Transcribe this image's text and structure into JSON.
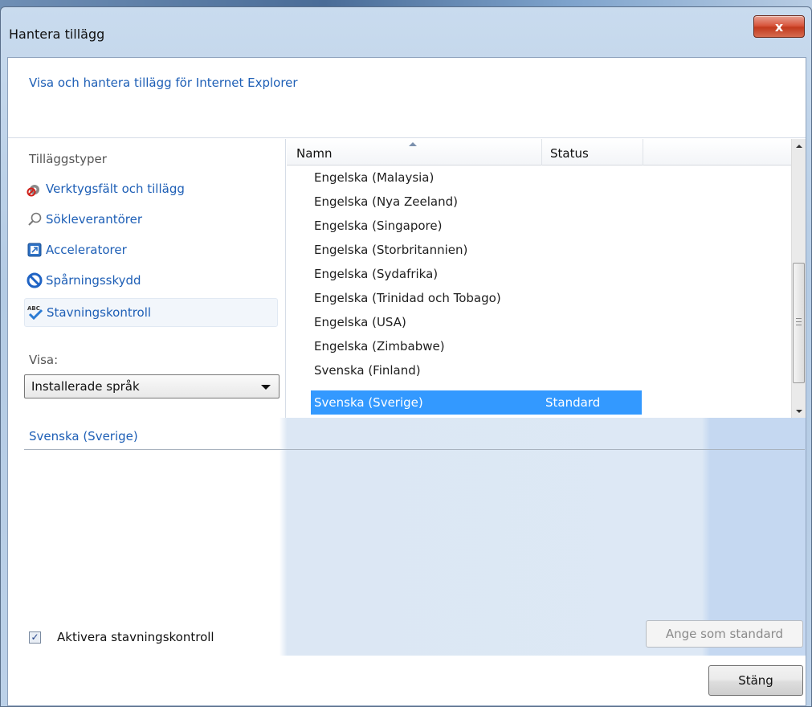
{
  "window": {
    "title": "Hantera tillägg",
    "close_glyph": "x"
  },
  "header": {
    "text": "Visa och hantera tillägg för Internet Explorer"
  },
  "left_pane": {
    "types_label": "Tilläggstyper",
    "items": [
      {
        "label": "Verktygsfält och tillägg",
        "icon": "gear-icon"
      },
      {
        "label": "Sökleverantörer",
        "icon": "search-icon"
      },
      {
        "label": "Acceleratorer",
        "icon": "accelerator-icon"
      },
      {
        "label": "Spårningsskydd",
        "icon": "block-icon"
      },
      {
        "label": "Stavningskontroll",
        "icon": "spellcheck-icon",
        "selected": true
      }
    ],
    "show_label": "Visa:",
    "show_value": "Installerade språk"
  },
  "list": {
    "columns": {
      "name": "Namn",
      "status": "Status"
    },
    "rows": [
      {
        "name": "Engelska (Malaysia)",
        "status": ""
      },
      {
        "name": "Engelska (Nya Zeeland)",
        "status": ""
      },
      {
        "name": "Engelska (Singapore)",
        "status": ""
      },
      {
        "name": "Engelska (Storbritannien)",
        "status": ""
      },
      {
        "name": "Engelska (Sydafrika)",
        "status": ""
      },
      {
        "name": "Engelska (Trinidad och Tobago)",
        "status": ""
      },
      {
        "name": "Engelska (USA)",
        "status": ""
      },
      {
        "name": "Engelska (Zimbabwe)",
        "status": ""
      },
      {
        "name": "Svenska (Finland)",
        "status": ""
      },
      {
        "name": "Svenska (Sverige)",
        "status": "Standard",
        "selected": true
      }
    ]
  },
  "details": {
    "title": "Svenska (Sverige)",
    "spellcheck_label": "Aktivera stavningskontroll",
    "spellcheck_checked": true,
    "set_default_label": "Ange som standard"
  },
  "footer": {
    "close_label": "Stäng"
  },
  "colors": {
    "link": "#1e5fb6",
    "selection": "#3399ff"
  }
}
